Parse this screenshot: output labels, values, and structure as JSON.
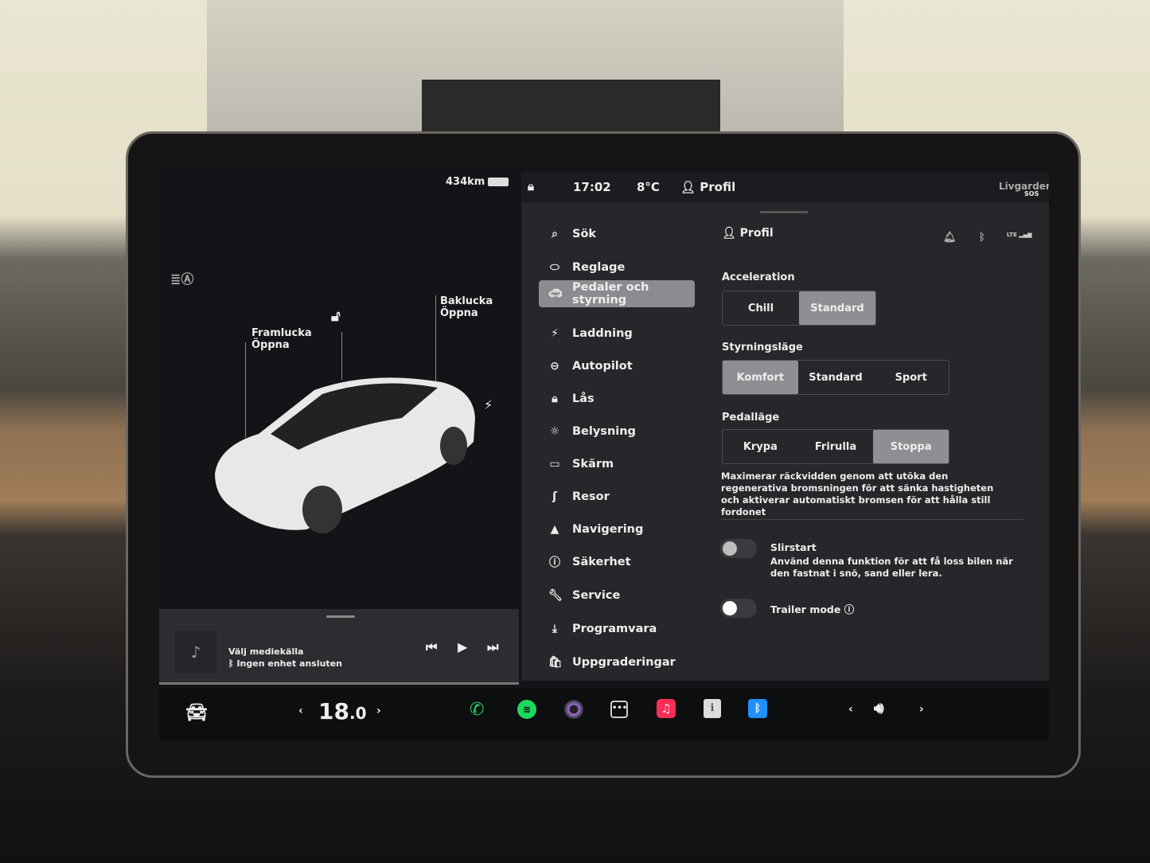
{
  "status": {
    "range": "434km",
    "time": "17:02",
    "temperature": "8°C",
    "profile": "Profil",
    "sos": "SOS",
    "map_label": "Livgarden"
  },
  "car": {
    "frunk_label": "Framlucka",
    "frunk_state": "Öppna",
    "trunk_label": "Baklucka",
    "trunk_state": "Öppna"
  },
  "menu": [
    {
      "label": "Sök",
      "icon": "search-icon"
    },
    {
      "label": "Reglage",
      "icon": "toggle-icon"
    },
    {
      "label": "Pedaler och styrning",
      "icon": "car-icon",
      "active": true
    },
    {
      "label": "Laddning",
      "icon": "bolt-icon"
    },
    {
      "label": "Autopilot",
      "icon": "steering-wheel-icon"
    },
    {
      "label": "Lås",
      "icon": "lock-icon"
    },
    {
      "label": "Belysning",
      "icon": "sun-icon"
    },
    {
      "label": "Skärm",
      "icon": "display-icon"
    },
    {
      "label": "Resor",
      "icon": "trips-icon"
    },
    {
      "label": "Navigering",
      "icon": "navigation-icon"
    },
    {
      "label": "Säkerhet",
      "icon": "safety-icon"
    },
    {
      "label": "Service",
      "icon": "wrench-icon"
    },
    {
      "label": "Programvara",
      "icon": "download-icon"
    },
    {
      "label": "Uppgraderingar",
      "icon": "bag-icon"
    }
  ],
  "settings": {
    "header": "Profil",
    "acceleration": {
      "label": "Acceleration",
      "options": [
        "Chill",
        "Standard"
      ],
      "selected": "Standard"
    },
    "steering": {
      "label": "Styrningsläge",
      "options": [
        "Komfort",
        "Standard",
        "Sport"
      ],
      "selected": "Komfort"
    },
    "pedal": {
      "label": "Pedalläge",
      "options": [
        "Krypa",
        "Frirulla",
        "Stoppa"
      ],
      "selected": "Stoppa",
      "description": "Maximerar räckvidden genom att utöka den regenerativa bromsningen för att sänka hastigheten och aktiverar automatiskt bromsen för att hålla still fordonet"
    },
    "slip_start": {
      "label": "Slirstart",
      "description": "Använd denna funktion för att få loss bilen när den fastnat i snö, sand eller lera.",
      "on": false
    },
    "trailer": {
      "label": "Trailer mode",
      "on": false
    },
    "lte": "LTE"
  },
  "media": {
    "title": "Välj mediekälla",
    "subtitle": "Ingen enhet ansluten"
  },
  "climate": {
    "temp_int": "18",
    "temp_dec": ".0"
  },
  "colors": {
    "accent_green": "#1ed760",
    "bluetooth": "#1e90ff",
    "music": "#fa2d55"
  }
}
